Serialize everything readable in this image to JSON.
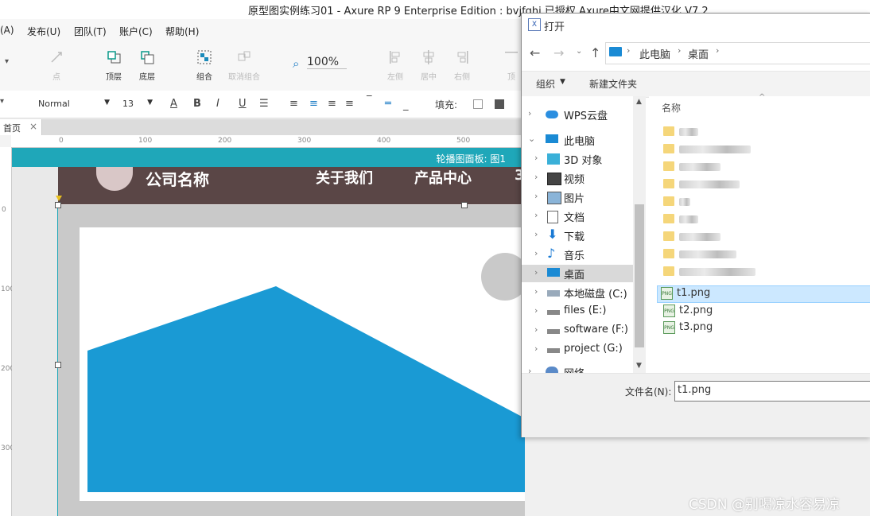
{
  "window": {
    "title": "原型图实例练习01 - Axure RP 9 Enterprise Edition : bvjfghj 已授权    Axure中文网提供汉化 V7.2"
  },
  "menu": [
    "(A)",
    "发布(U)",
    "团队(T)",
    "账户(C)",
    "帮助(H)"
  ],
  "toolbar": {
    "point_label": "点",
    "top_label": "顶层",
    "bottom_label": "底层",
    "group_label": "组合",
    "ungroup_label": "取消组合",
    "zoom": "100%",
    "left_label": "左侧",
    "center_label": "居中",
    "right_label": "右侧",
    "top_align_label": "顶"
  },
  "format": {
    "style": "Normal",
    "size": "13",
    "bold": "B",
    "italic": "I",
    "underline": "U",
    "fill_label": "填充:"
  },
  "tabs": {
    "home": "首页",
    "close": "×"
  },
  "ruler": {
    "h": [
      "0",
      "100",
      "200",
      "300",
      "400",
      "500"
    ],
    "v": [
      "0",
      "100",
      "200",
      "300"
    ]
  },
  "canvas": {
    "dynamic_panel": "轮播图面板: 图1",
    "company": "公司名称",
    "nav": [
      "关于我们",
      "产品中心",
      "3"
    ]
  },
  "dialog": {
    "title": "打开",
    "breadcrumb": [
      "此电脑",
      "桌面"
    ],
    "organize": "组织",
    "new_folder": "新建文件夹",
    "column_name": "名称",
    "nav_items": [
      "WPS云盘",
      "此电脑",
      "3D 对象",
      "视频",
      "图片",
      "文档",
      "下载",
      "音乐",
      "桌面",
      "本地磁盘 (C:)",
      "files (E:)",
      "software (F:)",
      "project (G:)",
      "网络"
    ],
    "files": [
      "t1.png",
      "t2.png",
      "t3.png"
    ],
    "filename_label": "文件名(N):",
    "filename_value": "t1.png"
  },
  "watermark": "CSDN @别喝凉水容易凉",
  "colors": {
    "accent": "#1fa7b9",
    "header": "#5a4646",
    "image_blue": "#1a9ad4",
    "selection": "#cce8ff"
  }
}
